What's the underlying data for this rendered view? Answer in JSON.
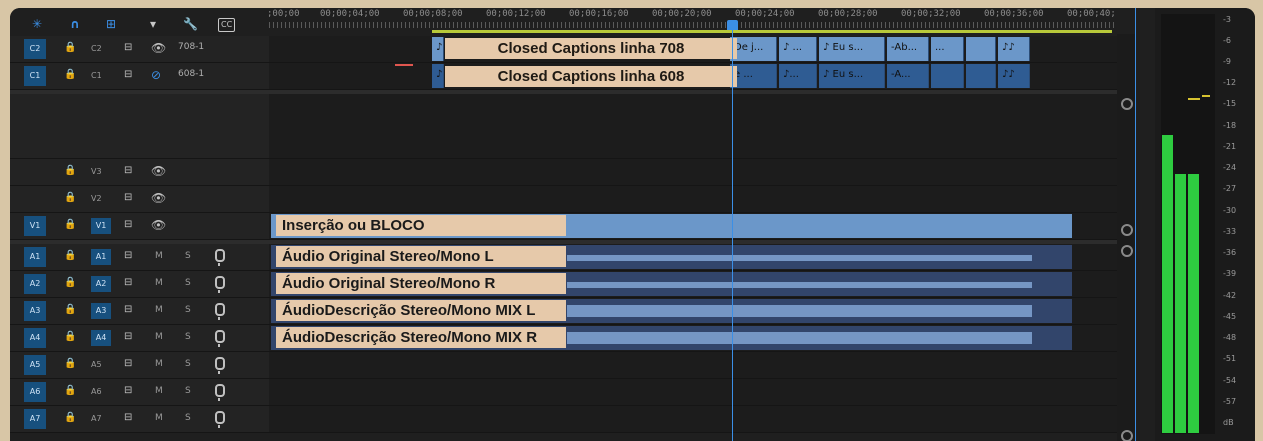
{
  "toolbar": {
    "icons": [
      "snap-icon",
      "magnet-icon",
      "linked-selection-icon",
      "add-marker-icon",
      "wrench-icon",
      "captions-icon"
    ],
    "captions_label": "CC"
  },
  "ruler": {
    "timecodes": [
      ";00;00",
      "00;00;04;00",
      "00;00;08;00",
      "00;00;12;00",
      "00;00;16;00",
      "00;00;20;00",
      "00;00;24;00",
      "00;00;28;00",
      "00;00;32;00",
      "00;00;36;00",
      "00;00;40;("
    ]
  },
  "captions": {
    "c2": {
      "chip": "C2",
      "name": "C2",
      "label": "708-1",
      "clip_label": "Closed Captions linha 708",
      "blocks": [
        "♪",
        "De j...",
        "♪ ...",
        "♪ Eu s...",
        "-Ab...",
        "...",
        "",
        "♪♪"
      ]
    },
    "c1": {
      "chip": "C1",
      "name": "C1",
      "label": "608-1",
      "clip_label": "Closed Captions linha 608",
      "blocks": [
        "♪",
        "e ...",
        "♪...",
        "♪ Eu s...",
        "-A...",
        "",
        "",
        "♪♪"
      ]
    }
  },
  "video": {
    "v3": {
      "name": "V3"
    },
    "v2": {
      "name": "V2"
    },
    "v1": {
      "chip": "V1",
      "name": "V1",
      "clip_label": "Inserção ou BLOCO"
    }
  },
  "audio": {
    "a1": {
      "chip": "A1",
      "name": "A1",
      "m": "M",
      "s": "S",
      "clip_label": "Áudio Original Stereo/Mono L"
    },
    "a2": {
      "chip": "A2",
      "name": "A2",
      "m": "M",
      "s": "S",
      "clip_label": "Áudio Original Stereo/Mono R"
    },
    "a3": {
      "chip": "A3",
      "name": "A3",
      "m": "M",
      "s": "S",
      "clip_label": "ÁudioDescrição Stereo/Mono MIX L"
    },
    "a4": {
      "chip": "A4",
      "name": "A4",
      "m": "M",
      "s": "S",
      "clip_label": "ÁudioDescrição Stereo/Mono MIX R"
    },
    "a5": {
      "chip": "A5",
      "name": "A5",
      "m": "M",
      "s": "S"
    },
    "a6": {
      "chip": "A6",
      "name": "A6",
      "m": "M",
      "s": "S"
    },
    "a7": {
      "chip": "A7",
      "name": "A7",
      "m": "M",
      "s": "S"
    }
  },
  "meter": {
    "labels": [
      "-3",
      "-6",
      "-9",
      "-12",
      "-15",
      "-18",
      "-21",
      "-24",
      "-27",
      "-30",
      "-33",
      "-36",
      "-39",
      "-42",
      "-45",
      "-48",
      "-51",
      "-54",
      "-57",
      "dB"
    ],
    "levels_db": [
      -18,
      -24,
      -24
    ],
    "peak_db": -15,
    "color": "#2ecc40"
  },
  "colors": {
    "accent": "#17507e",
    "clip": "#6b97c9",
    "audio_clip": "#32456b",
    "label_bg": "#e6c9aa",
    "playhead": "#3b8fe6"
  }
}
